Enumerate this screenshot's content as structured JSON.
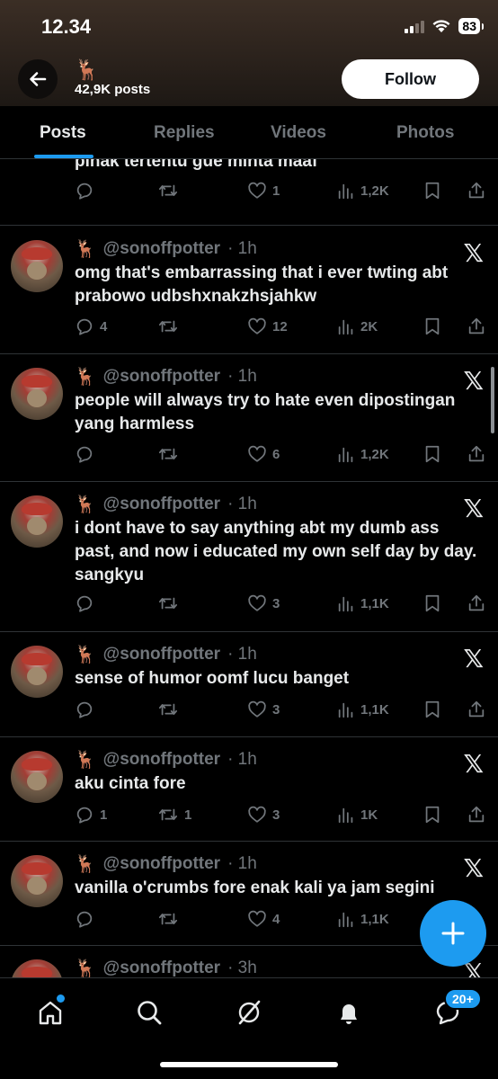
{
  "status": {
    "time": "12.34",
    "battery": "83"
  },
  "header": {
    "emoji": "🦌",
    "posts_count": "42,9K posts",
    "follow_label": "Follow"
  },
  "tabs": [
    {
      "label": "Posts",
      "active": true
    },
    {
      "label": "Replies",
      "active": false
    },
    {
      "label": "Videos",
      "active": false
    },
    {
      "label": "Photos",
      "active": false
    }
  ],
  "tweets": [
    {
      "partial": true,
      "emoji": "",
      "handle": "",
      "time": "",
      "text": "pihak tertentu gue minta maaf",
      "replies": "",
      "retweets": "",
      "likes": "1",
      "views": "1,2K"
    },
    {
      "emoji": "🦌",
      "handle": "@sonoffpotter",
      "time": "· 1h",
      "text": "omg that's embarrassing that i ever twting abt prabowo udbshxnakzhsjahkw",
      "replies": "4",
      "retweets": "",
      "likes": "12",
      "views": "2K"
    },
    {
      "emoji": "🦌",
      "handle": "@sonoffpotter",
      "time": "· 1h",
      "text": "people will always try to hate even dipostingan yang harmless",
      "replies": "",
      "retweets": "",
      "likes": "6",
      "views": "1,2K"
    },
    {
      "emoji": "🦌",
      "handle": "@sonoffpotter",
      "time": "· 1h",
      "text": "i dont have to say anything abt my dumb ass past, and now i educated my own self day by day. sangkyu",
      "replies": "",
      "retweets": "",
      "likes": "3",
      "views": "1,1K"
    },
    {
      "emoji": "🦌",
      "handle": "@sonoffpotter",
      "time": "· 1h",
      "text": "sense of humor oomf lucu banget",
      "replies": "",
      "retweets": "",
      "likes": "3",
      "views": "1,1K"
    },
    {
      "emoji": "🦌",
      "handle": "@sonoffpotter",
      "time": "· 1h",
      "text": "aku cinta fore",
      "replies": "1",
      "retweets": "1",
      "likes": "3",
      "views": "1K"
    },
    {
      "emoji": "🦌",
      "handle": "@sonoffpotter",
      "time": "· 1h",
      "text": "vanilla o'crumbs fore enak kali ya jam segini",
      "replies": "",
      "retweets": "",
      "likes": "4",
      "views": "1,1K"
    },
    {
      "emoji": "🦌",
      "handle": "@sonoffpotter",
      "time": "· 3h",
      "text": "",
      "replies": "",
      "retweets": "",
      "likes": "",
      "views": ""
    }
  ],
  "x_logo": "𝕏",
  "nav": {
    "messages_badge": "20+"
  },
  "colors": {
    "accent": "#1d9bf0",
    "background": "#000000",
    "text_primary": "#e7e9ea",
    "text_secondary": "#71767b"
  },
  "icons": [
    "back-arrow-icon",
    "reply-icon",
    "retweet-icon",
    "like-icon",
    "views-icon",
    "bookmark-icon",
    "share-icon",
    "x-logo-icon",
    "compose-plus-icon",
    "home-icon",
    "search-icon",
    "grok-icon",
    "bell-icon",
    "messages-icon"
  ]
}
